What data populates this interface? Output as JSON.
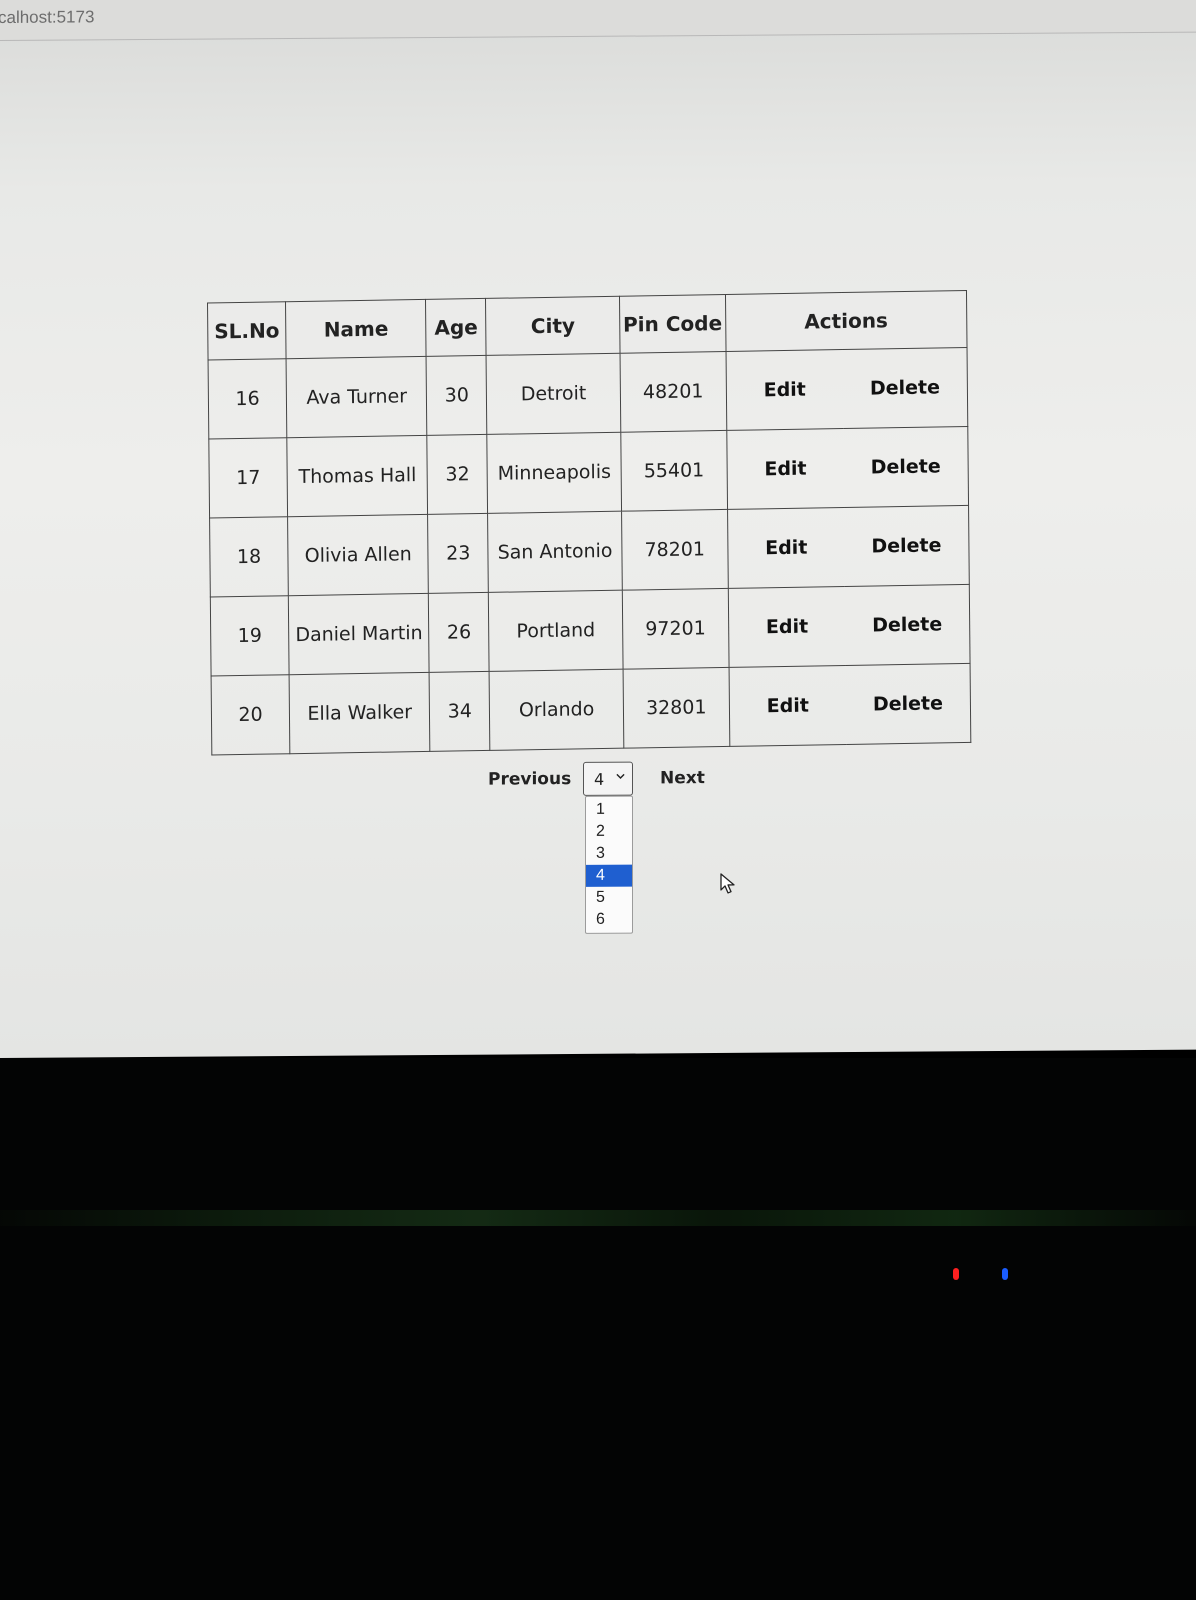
{
  "browser": {
    "url_fragment": "calhost:5173"
  },
  "table": {
    "headers": {
      "sl_no": "SL.No",
      "name": "Name",
      "age": "Age",
      "city": "City",
      "pin_code": "Pin Code",
      "actions": "Actions"
    },
    "rows": [
      {
        "sl_no": "16",
        "name": "Ava Turner",
        "age": "30",
        "city": "Detroit",
        "pin_code": "48201",
        "edit": "Edit",
        "delete": "Delete"
      },
      {
        "sl_no": "17",
        "name": "Thomas Hall",
        "age": "32",
        "city": "Minneapolis",
        "pin_code": "55401",
        "edit": "Edit",
        "delete": "Delete"
      },
      {
        "sl_no": "18",
        "name": "Olivia Allen",
        "age": "23",
        "city": "San Antonio",
        "pin_code": "78201",
        "edit": "Edit",
        "delete": "Delete"
      },
      {
        "sl_no": "19",
        "name": "Daniel Martin",
        "age": "26",
        "city": "Portland",
        "pin_code": "97201",
        "edit": "Edit",
        "delete": "Delete"
      },
      {
        "sl_no": "20",
        "name": "Ella Walker",
        "age": "34",
        "city": "Orlando",
        "pin_code": "32801",
        "edit": "Edit",
        "delete": "Delete"
      }
    ]
  },
  "pagination": {
    "previous_label": "Previous",
    "next_label": "Next",
    "page_select_value": "4",
    "page_options": [
      "1",
      "2",
      "3",
      "4",
      "5",
      "6"
    ],
    "selected_page_index": 3
  },
  "colors": {
    "selected_option_bg": "#1f5fd0",
    "screen_bg": "#eeeeec",
    "table_border": "#444444"
  },
  "icons": {
    "select_chevron": "chevron-down-icon",
    "mouse_pointer": "mouse-pointer-icon"
  }
}
